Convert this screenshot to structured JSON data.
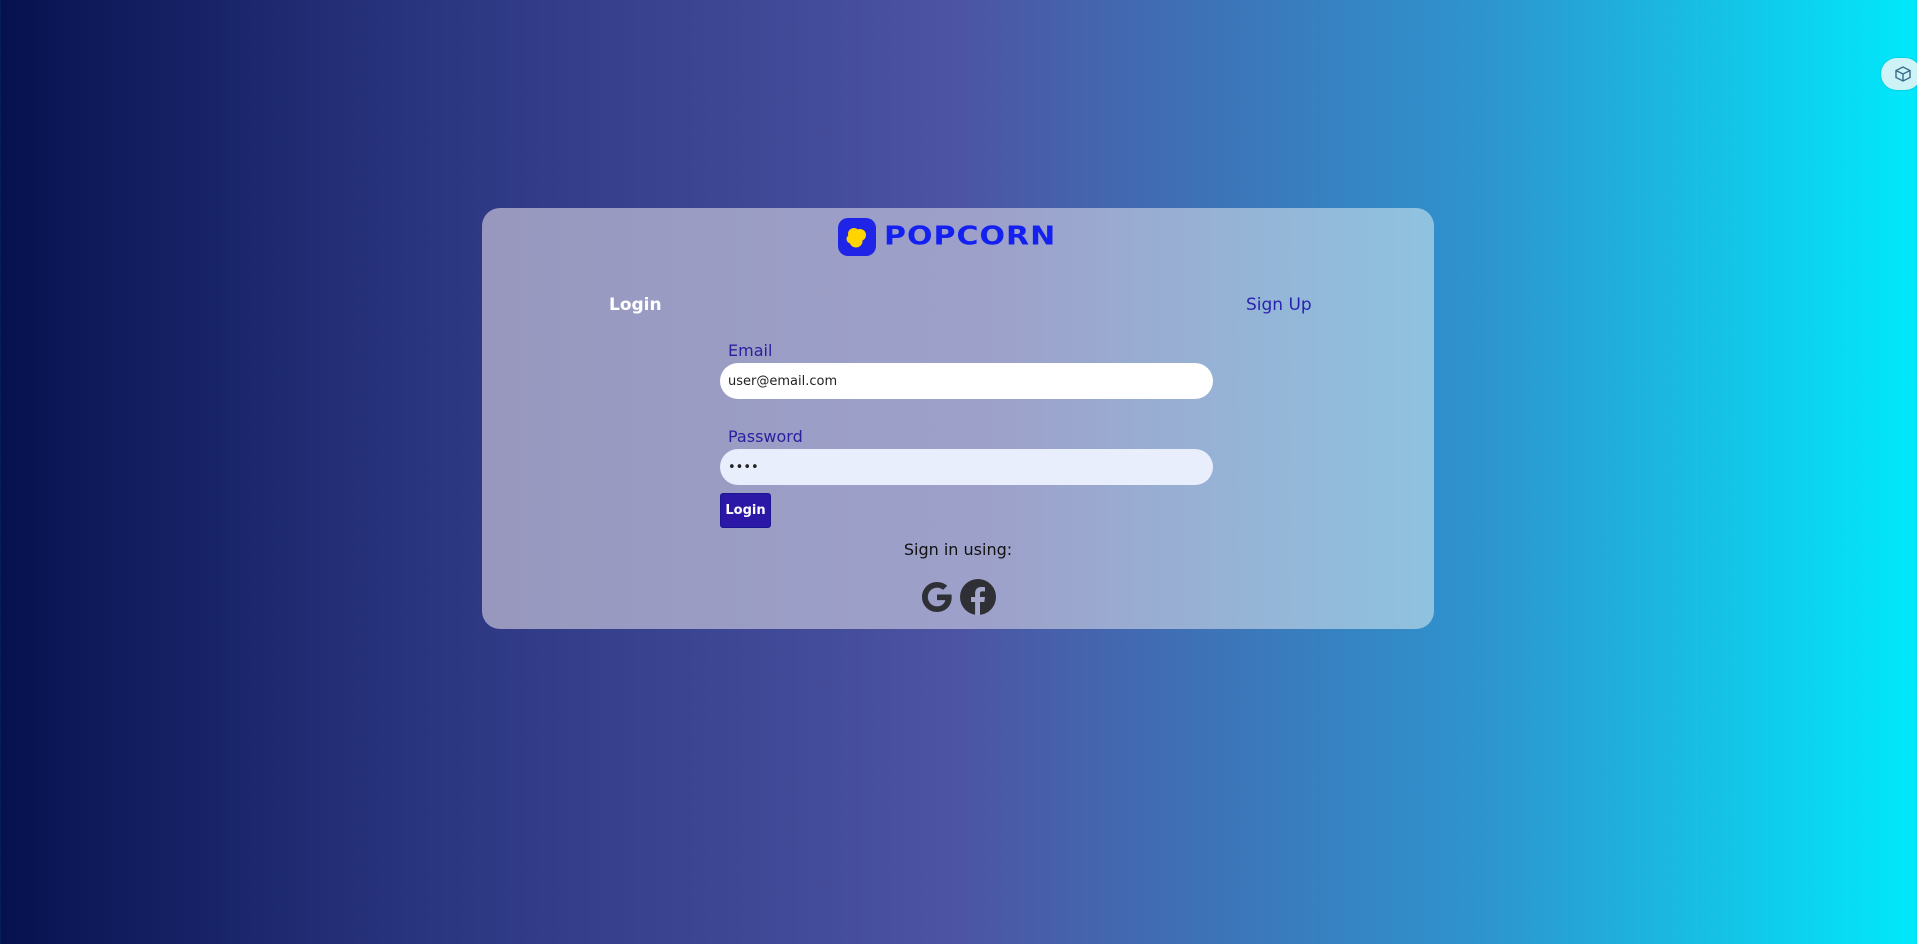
{
  "brand": {
    "name": "POPCORN",
    "color": "#1320f0",
    "badge_color": "#1f24e6",
    "kernel_color": "#ffd400"
  },
  "tabs": {
    "login": "Login",
    "signup": "Sign Up"
  },
  "form": {
    "email_label": "Email",
    "email_value": "user@email.com",
    "password_label": "Password",
    "password_value": "••••",
    "submit_label": "Login"
  },
  "social": {
    "heading": "Sign in using:",
    "providers": [
      "google-icon",
      "facebook-icon"
    ]
  },
  "colors": {
    "background_start": "#06124f",
    "background_mid": "#4c54a3",
    "background_end": "#00e9fb",
    "button": "#2c18a6",
    "label": "#2a1f9e"
  }
}
